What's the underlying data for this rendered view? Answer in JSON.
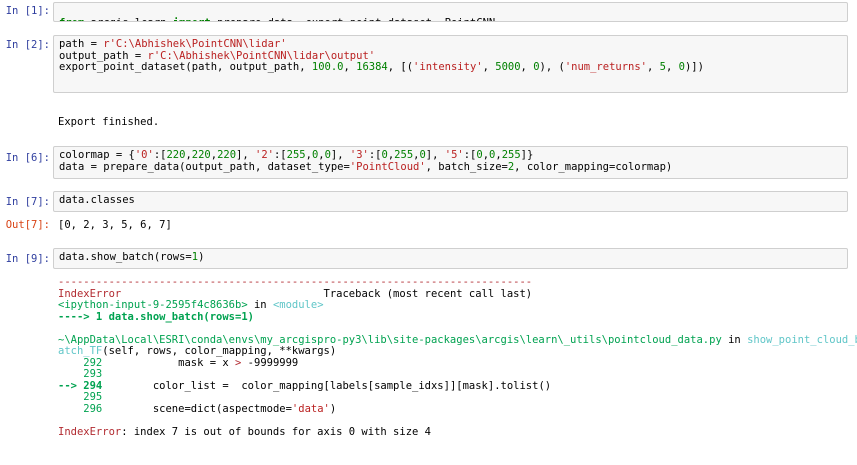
{
  "cells": [
    {
      "prompt": "In [1]:",
      "code": "from arcgis.learn import prepare_data, export_point_dataset, PointCNN"
    },
    {
      "prompt": "In [2]:",
      "lines": [
        "path = r'C:\\Abhishek\\PointCNN\\lidar'",
        "output_path = r'C:\\Abhishek\\PointCNN\\lidar\\output'",
        "export_point_dataset(path, output_path, 100.0, 16384, [('intensity', 5000, 0), ('num_returns', 5, 0)])"
      ],
      "output": "Export finished."
    },
    {
      "prompt": "In [6]:",
      "lines": [
        "colormap = {'0':[220,220,220], '2':[255,0,0], '3':[0,255,0], '5':[0,0,255]}",
        "data = prepare_data(output_path, dataset_type='PointCloud', batch_size=2, color_mapping=colormap)"
      ]
    },
    {
      "prompt": "In [7]:",
      "code": "data.classes",
      "out_prompt": "Out[7]:",
      "output": "[0, 2, 3, 5, 6, 7]"
    },
    {
      "prompt": "In [9]:",
      "code": "data.show_batch(rows=1)"
    }
  ],
  "traceback": {
    "dashes": "---------------------------------------------------------------------------",
    "error_type": "IndexError",
    "traceback_label": "Traceback (most recent call last)",
    "input_ref": "<ipython-input-9-2595f4c8636b>",
    "in_word": " in ",
    "module": "<module>",
    "arrow_line": "----> 1 data.show_batch(rows=1)",
    "file_path": "~\\AppData\\Local\\ESRI\\conda\\envs\\my_arcgispro-py3\\lib\\site-packages\\arcgis\\learn\\_utils\\pointcloud_data.py",
    "in_word2": " in ",
    "func_part1": "show_point_cloud_b",
    "func_part2": "atch_TF",
    "signature": "(self, rows, color_mapping, **kwargs)",
    "src": [
      {
        "no": "    292",
        "code": "            mask = x > -9999999"
      },
      {
        "no": "    293",
        "code": ""
      },
      {
        "no": "--> 294",
        "code": "        color_list =  color_mapping[labels[sample_idxs]][mask].tolist()"
      },
      {
        "no": "    295",
        "code": ""
      },
      {
        "no": "    296",
        "code": "        scene=dict(aspectmode='data')"
      }
    ],
    "final_type": "IndexError",
    "final_msg": ": index 7 is out of bounds for axis 0 with size 4"
  }
}
